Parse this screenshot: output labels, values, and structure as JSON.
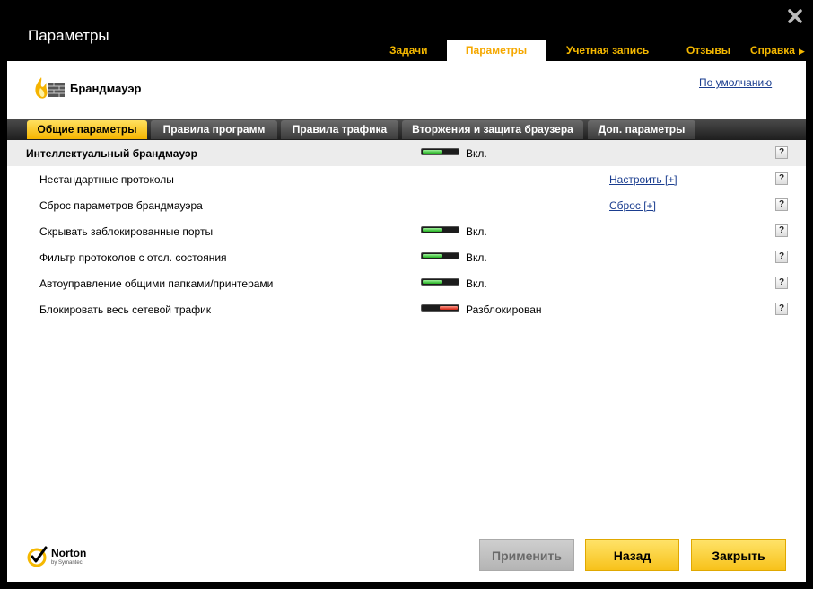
{
  "window": {
    "title": "Параметры"
  },
  "topnav": {
    "tasks": "Задачи",
    "params": "Параметры",
    "account": "Учетная запись",
    "reviews": "Отзывы",
    "help": "Справка"
  },
  "header": {
    "title": "Брандмауэр",
    "defaults_link": "По умолчанию"
  },
  "tabs": {
    "general": "Общие параметры",
    "programs": "Правила программ",
    "traffic": "Правила трафика",
    "intrusion": "Вторжения и защита браузера",
    "advanced": "Доп. параметры",
    "active": "general"
  },
  "rows": [
    {
      "label": "Интеллектуальный брандмауэр",
      "switch": "on",
      "state": "Вкл.",
      "help": "?"
    },
    {
      "label": "Нестандартные протоколы",
      "link": "Настроить [+]",
      "help": "?"
    },
    {
      "label": "Сброс параметров брандмауэра",
      "link": "Сброс [+]",
      "help": "?"
    },
    {
      "label": "Скрывать заблокированные порты",
      "switch": "on",
      "state": "Вкл.",
      "help": "?"
    },
    {
      "label": "Фильтр протоколов с отсл. состояния",
      "switch": "on",
      "state": "Вкл.",
      "help": "?"
    },
    {
      "label": "Автоуправление общими папками/принтерами",
      "switch": "on",
      "state": "Вкл.",
      "help": "?"
    },
    {
      "label": "Блокировать весь сетевой трафик",
      "switch": "off",
      "state": "Разблокирован",
      "help": "?"
    }
  ],
  "footer": {
    "brand": "Norton",
    "brand_sub": "by Symantec",
    "apply": "Применить",
    "back": "Назад",
    "close": "Закрыть"
  },
  "colors": {
    "accent": "#f5b800",
    "switch_on": "#22b020",
    "switch_off": "#d02010",
    "link": "#1a3d8f"
  }
}
